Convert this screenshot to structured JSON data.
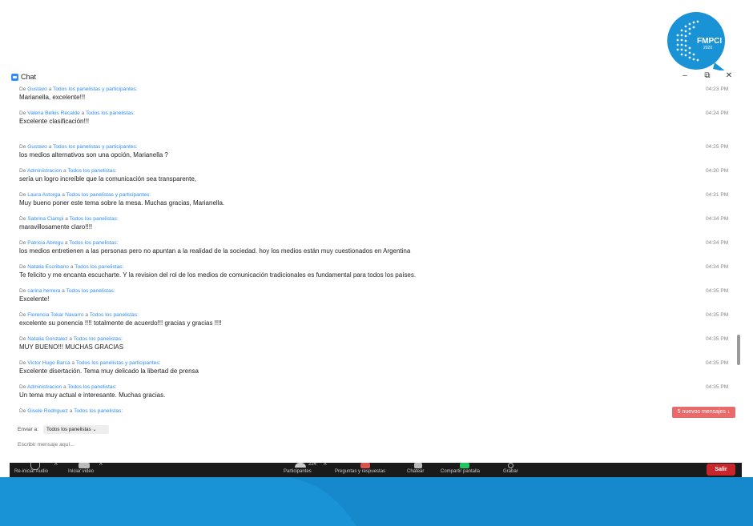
{
  "logo": {
    "text": "FMPCI",
    "year": "2020",
    "color": "#1a93d6"
  },
  "window": {
    "title": "Chat",
    "minimize": "–",
    "restore": "⧉",
    "close": "✕"
  },
  "messages": [
    {
      "from_label": "De",
      "sender": "Gustavo",
      "sep": "a",
      "dest": "Todos los panelistas y participantes:",
      "time": "04:23 PM",
      "text": "Marianella, excelente!!!"
    },
    {
      "from_label": "De",
      "sender": "Valeria  Belkis Recalde",
      "sep": "a",
      "dest": "Todos los panelistas:",
      "time": "04:24 PM",
      "text": "Excelente clasificación!!!"
    },
    {
      "from_label": "De",
      "sender": "Gustavo",
      "sep": "a",
      "dest": "Todos los panelistas y participantes:",
      "time": "04:25 PM",
      "text": "los medios alternativos son una opción, Marianella ?"
    },
    {
      "from_label": "De",
      "sender": "Administracion",
      "sep": "a",
      "dest": "Todos los panelistas:",
      "time": "04:30 PM",
      "text": "sería un logro increíble  que la comunicación sea transparente,"
    },
    {
      "from_label": "De",
      "sender": "Laura Astorga",
      "sep": "a",
      "dest": "Todos los panelistas y participantes:",
      "time": "04:31 PM",
      "text": "Muy bueno poner este tema sobre la mesa. Muchas gracias, Marianella."
    },
    {
      "from_label": "De",
      "sender": "Sabrina Ciampi",
      "sep": "a",
      "dest": "Todos los panelistas:",
      "time": "04:34 PM",
      "text": "maravillosamente claro!!!!"
    },
    {
      "from_label": "De",
      "sender": "Patricia Abregu",
      "sep": "a",
      "dest": "Todos los panelistas:",
      "time": "04:34 PM",
      "text": "los medios entretienen a las personas pero no apuntan a la realidad de la sociedad. hoy los medios están muy cuestionados en Argentina"
    },
    {
      "from_label": "De",
      "sender": "Natalia Escribano",
      "sep": "a",
      "dest": "Todos los panelistas:",
      "time": "04:34 PM",
      "text": "Te felicito y me encanta escucharte. Y la revision del rol de los medios de comunicación tradicionales es fundamental para todos los países."
    },
    {
      "from_label": "De",
      "sender": "carina herrera",
      "sep": "a",
      "dest": "Todos los panelistas:",
      "time": "04:35 PM",
      "text": "Excelente!"
    },
    {
      "from_label": "De",
      "sender": "Florencia Tokar Navarro",
      "sep": "a",
      "dest": "Todos los panelistas:",
      "time": "04:35 PM",
      "text": "excelente su ponencia !!!! totalmente de acuerdo!!! gracias y gracias !!!!"
    },
    {
      "from_label": "De",
      "sender": "Natalia Gonzalez",
      "sep": "a",
      "dest": "Todos los panelistas:",
      "time": "04:35 PM",
      "text": "MUY BUENO!!! MUCHAS GRACIAS"
    },
    {
      "from_label": "De",
      "sender": "Victor Hugo Barca",
      "sep": "a",
      "dest": "Todos los panelistas y participantes:",
      "time": "04:35 PM",
      "text": "Excelente disertación. Tema muy delicado la libertad de prensa"
    },
    {
      "from_label": "De",
      "sender": "Administracion",
      "sep": "a",
      "dest": "Todos los panelistas:",
      "time": "04:35 PM",
      "text": "Un tema muy actual e interesante. Muchas gracias."
    },
    {
      "from_label": "De",
      "sender": "Gisele Rodriguez",
      "sep": "a",
      "dest": "Todos los panelistas:",
      "time": "",
      "text": ""
    }
  ],
  "new_messages_badge": "5 nuevos mensajes ↓",
  "send": {
    "label": "Enviar a:",
    "selected": "Todos los panelistas ⌄"
  },
  "compose": {
    "placeholder": "Escribir mensaje aquí..."
  },
  "toolbar": {
    "items": [
      {
        "label": "Re-iniciar Audio",
        "icon": "microphone-muted-icon"
      },
      {
        "label": "Iniciar video",
        "icon": "video-off-icon"
      },
      {
        "label": "Participantes",
        "icon": "participants-icon",
        "count": "224"
      },
      {
        "label": "Preguntas y respuestas",
        "icon": "qa-icon"
      },
      {
        "label": "Chatear",
        "icon": "chat-icon"
      },
      {
        "label": "Compartir pantalla",
        "icon": "share-screen-icon"
      },
      {
        "label": "Grabar",
        "icon": "record-icon"
      }
    ],
    "exit_label": "Salir"
  },
  "colors": {
    "accent": "#2d8cff",
    "badge": "#e96a6a",
    "exit": "#c8262d",
    "band": "#1a93d6"
  }
}
